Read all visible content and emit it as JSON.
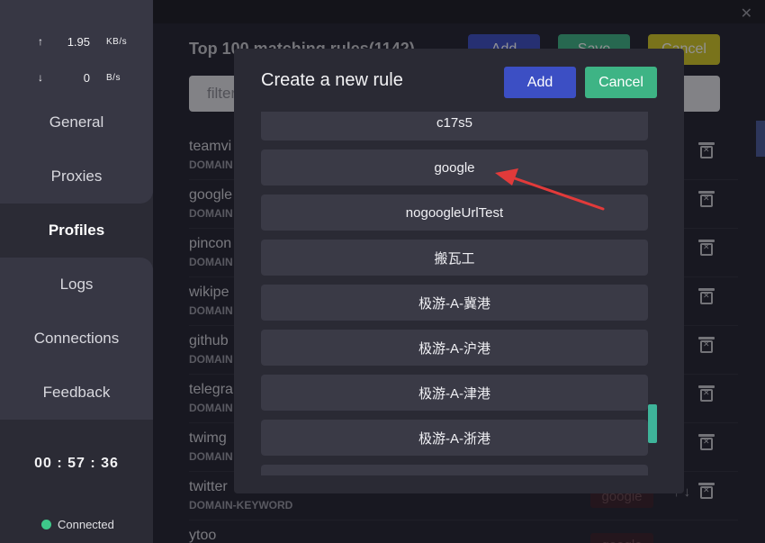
{
  "sidebar": {
    "upload": {
      "arrow": "↑",
      "value": "1.95",
      "unit": "KB/s"
    },
    "download": {
      "arrow": "↓",
      "value": "0",
      "unit": "B/s"
    },
    "nav": [
      {
        "label": "General"
      },
      {
        "label": "Proxies"
      },
      {
        "label": "Profiles"
      },
      {
        "label": "Logs"
      },
      {
        "label": "Connections"
      },
      {
        "label": "Feedback"
      }
    ],
    "timer": "00 : 57 : 36",
    "status": "Connected",
    "status_color": "#3ec98a"
  },
  "main": {
    "close_symbol": "✕",
    "title": "Top 100 matching rules(1142)",
    "buttons": {
      "add": "Add",
      "save": "Save",
      "cancel": "Cancel"
    },
    "filter_placeholder": "filter",
    "rules": [
      {
        "name": "teamvi",
        "type": "DOMAIN"
      },
      {
        "name": "google",
        "type": "DOMAIN"
      },
      {
        "name": "pincon",
        "type": "DOMAIN"
      },
      {
        "name": "wikipe",
        "type": "DOMAIN"
      },
      {
        "name": "github",
        "type": "DOMAIN"
      },
      {
        "name": "telegra",
        "type": "DOMAIN"
      },
      {
        "name": "twimg",
        "type": "DOMAIN"
      },
      {
        "name": "twitter",
        "type": "DOMAIN-KEYWORD",
        "proxy": "google"
      },
      {
        "name": "ytoo",
        "type": "",
        "proxy": "google"
      }
    ]
  },
  "modal": {
    "title": "Create a new rule",
    "add_label": "Add",
    "cancel_label": "Cancel",
    "options": [
      "c17s5",
      "google",
      "nogoogleUrlTest",
      "搬瓦工",
      "极游-A-冀港",
      "极游-A-沪港",
      "极游-A-津港",
      "极游-A-浙港",
      ""
    ]
  },
  "colors": {
    "accent_blue": "#3c4fc4",
    "accent_green": "#3eb485",
    "annotation_arrow": "#e23a3a"
  }
}
